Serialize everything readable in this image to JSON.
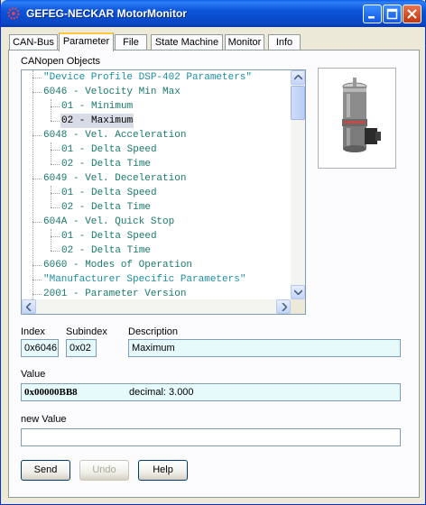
{
  "window": {
    "title": "GEFEG-NECKAR MotorMonitor"
  },
  "tabs": [
    {
      "label": "CAN-Bus"
    },
    {
      "label": "Parameter",
      "active": true
    },
    {
      "label": "File"
    },
    {
      "label": "State Machine"
    },
    {
      "label": "Monitor"
    },
    {
      "label": "Info"
    }
  ],
  "tree": {
    "label": "CANopen Objects",
    "items": [
      {
        "text": "\"Device Profile DSP-402 Parameters\""
      },
      {
        "text": "6046 - Velocity Min Max"
      },
      {
        "text": "01 - Minimum"
      },
      {
        "text": "02 - Maximum"
      },
      {
        "text": "6048 - Vel. Acceleration"
      },
      {
        "text": "01 - Delta Speed"
      },
      {
        "text": "02 - Delta Time"
      },
      {
        "text": "6049 - Vel. Deceleration"
      },
      {
        "text": "01 - Delta Speed"
      },
      {
        "text": "02 - Delta Time"
      },
      {
        "text": "604A - Vel. Quick Stop"
      },
      {
        "text": "01 - Delta Speed"
      },
      {
        "text": "02 - Delta Time"
      },
      {
        "text": "6060 - Modes of Operation"
      },
      {
        "text": "\"Manufacturer Specific Parameters\""
      },
      {
        "text": "2001 - Parameter Version"
      }
    ]
  },
  "details": {
    "index_label": "Index",
    "subindex_label": "Subindex",
    "description_label": "Description",
    "index_value": "0x6046",
    "subindex_value": "0x02",
    "description_value": "Maximum",
    "value_label": "Value",
    "value_hex": "0x00000BB8",
    "value_decimal": "decimal:  3.000",
    "new_value_label": "new Value",
    "new_value": ""
  },
  "buttons": {
    "send": "Send",
    "undo": "Undo",
    "help": "Help"
  },
  "colors": {
    "title_bar": "#0a55d8",
    "tree_text": "#1a7a6a",
    "field_background": "#e6fafc",
    "active_tab_accent": "#ffc83c"
  }
}
